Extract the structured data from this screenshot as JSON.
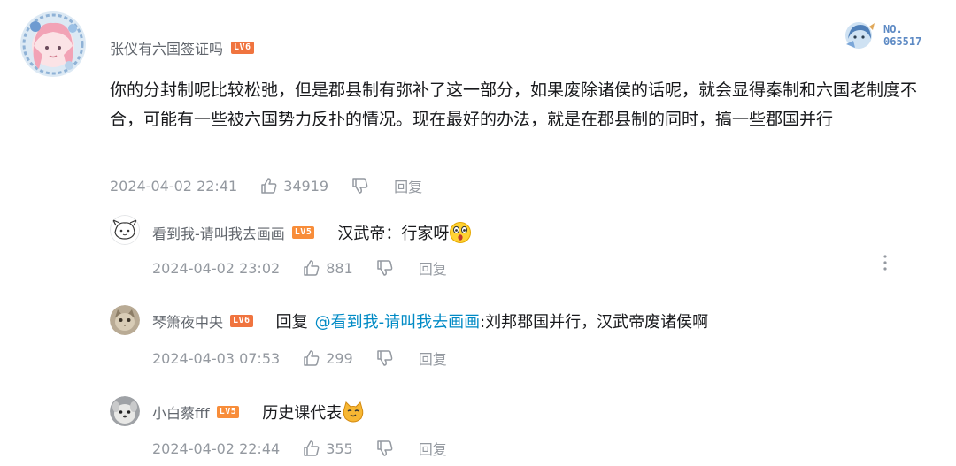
{
  "main_comment": {
    "username": "张仪有六国签证吗",
    "level": "LV6",
    "badge_label": "NO.",
    "badge_number": "065517",
    "text": "你的分封制呢比较松弛，但是郡县制有弥补了这一部分，如果废除诸侯的话呢，就会显得秦制和六国老制度不合，可能有一些被六国势力反扑的情况。现在最好的办法，就是在郡县制的同时，搞一些郡国并行",
    "date": "2024-04-02 22:41",
    "likes": "34919",
    "reply_label": "回复"
  },
  "replies": [
    {
      "username": "看到我-请叫我去画画",
      "level": "LV5",
      "text": "汉武帝：行家呀",
      "emoji": "surprised-face-emoji",
      "date": "2024-04-02 23:02",
      "likes": "881",
      "reply_label": "回复"
    },
    {
      "username": "琴箫夜中央",
      "level": "LV6",
      "reply_prefix": "回复",
      "mention": "@看到我-请叫我去画画",
      "text": " :刘邦郡国并行，汉武帝废诸侯啊",
      "date": "2024-04-03 07:53",
      "likes": "299",
      "reply_label": "回复"
    },
    {
      "username": "小白蔡fff",
      "level": "LV5",
      "text": "历史课代表",
      "emoji": "cat-emoji",
      "date": "2024-04-02 22:44",
      "likes": "355",
      "reply_label": "回复"
    }
  ],
  "colors": {
    "username": "#61666d",
    "meta": "#9499a0",
    "mention": "#008ac5",
    "level6": "#f0743f",
    "level5": "#f88d3a"
  }
}
